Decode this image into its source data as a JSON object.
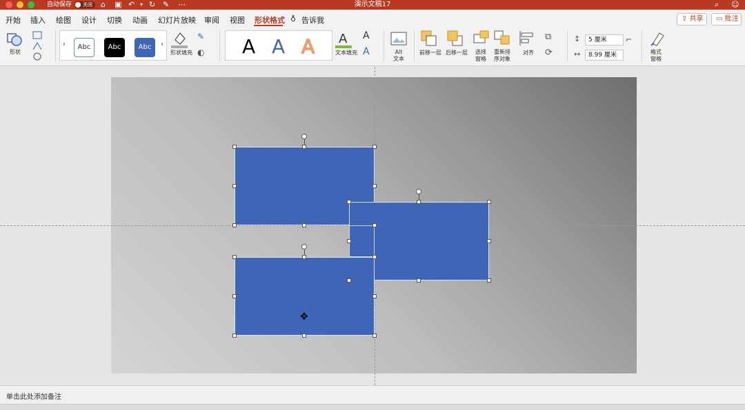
{
  "titlebar": {
    "autosave_label": "自动保存",
    "autosave_state": "关闭",
    "document_title": "演示文稿17",
    "background_color": "#b83a22"
  },
  "tabs": [
    {
      "label": "开始"
    },
    {
      "label": "插入"
    },
    {
      "label": "绘图"
    },
    {
      "label": "设计"
    },
    {
      "label": "切换"
    },
    {
      "label": "动画"
    },
    {
      "label": "幻灯片放映"
    },
    {
      "label": "审阅"
    },
    {
      "label": "视图"
    },
    {
      "label": "形状格式",
      "active": true
    },
    {
      "label": "告诉我"
    }
  ],
  "actions": {
    "share_label": "共享",
    "comment_label": "批注"
  },
  "ribbon": {
    "shape_label": "形状",
    "style_samples": [
      "Abc",
      "Abc",
      "Abc"
    ],
    "shape_fill_label": "形状填充",
    "wordart_samples": [
      "A",
      "A",
      "A"
    ],
    "text_fill_label": "文本填充",
    "alt_text_label": "Alt\n文本",
    "bring_forward_label": "前移一层",
    "send_backward_label": "后移一层",
    "selection_pane_label": "选择\n窗格",
    "reorder_label": "重新排\n序对象",
    "align_label": "对齐",
    "height_value": "5 厘米",
    "width_value": "8.99 厘米",
    "format_pane_label": "格式\n窗格"
  },
  "notes": {
    "placeholder": "单击此处添加备注"
  },
  "colors": {
    "accent": "#b83a22",
    "shape_fill": "#3f65b7"
  }
}
